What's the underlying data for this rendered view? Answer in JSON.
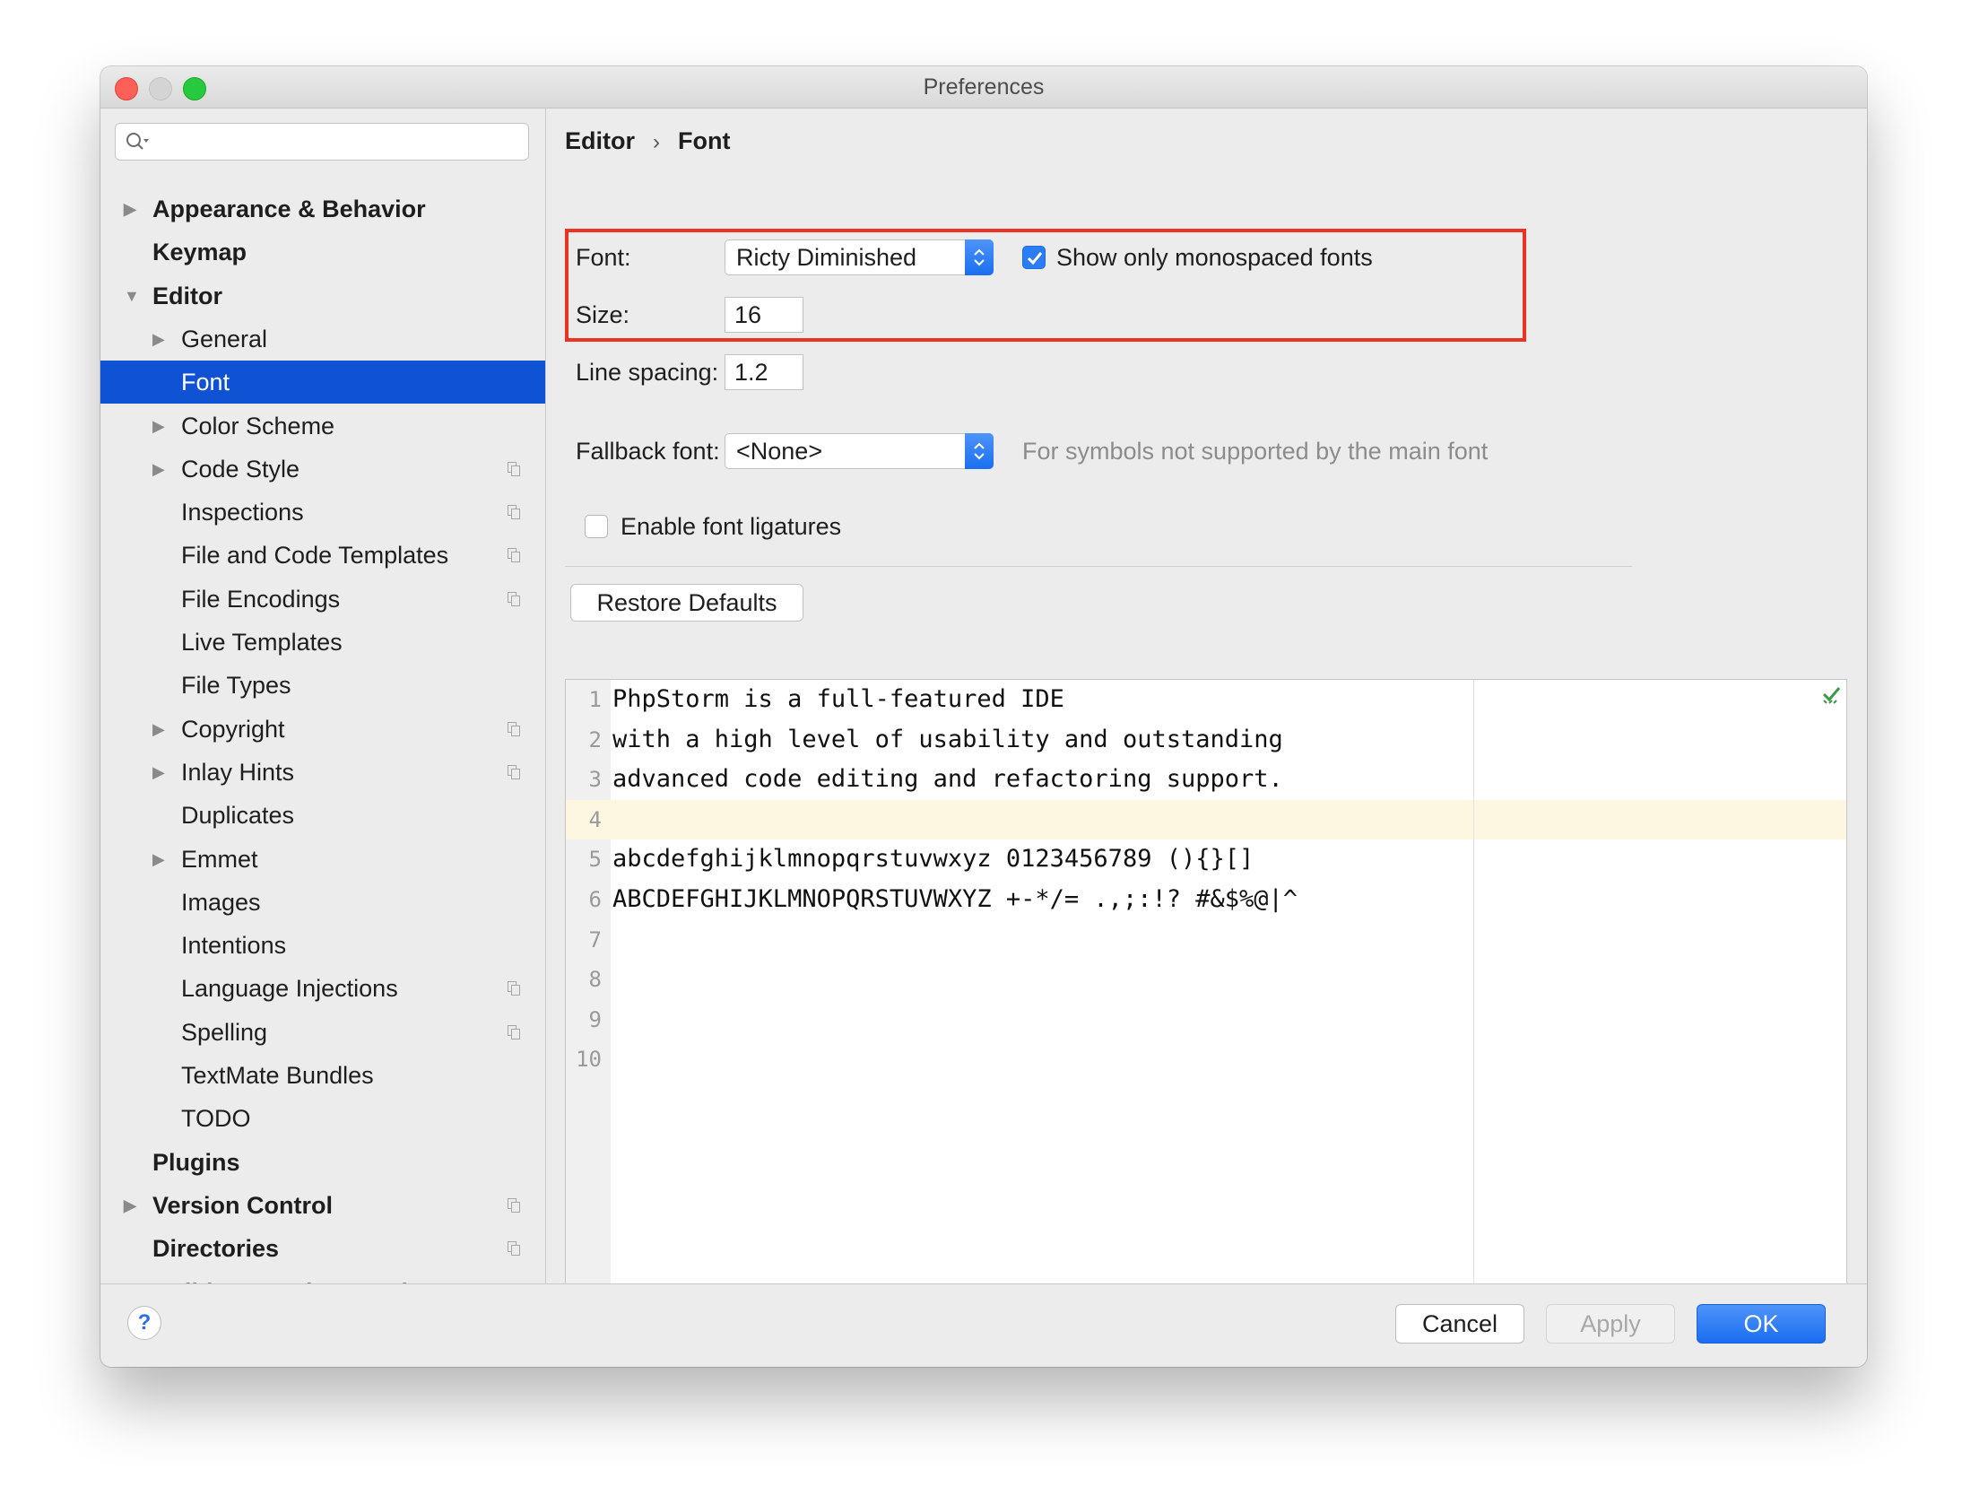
{
  "window": {
    "title": "Preferences"
  },
  "search": {
    "placeholder": ""
  },
  "sidebar": {
    "items": [
      {
        "label": "Appearance & Behavior",
        "level": 0,
        "arrow": "collapsed",
        "bold": true,
        "project": false,
        "selected": false
      },
      {
        "label": "Keymap",
        "level": 0,
        "arrow": "none",
        "bold": true,
        "project": false,
        "selected": false
      },
      {
        "label": "Editor",
        "level": 0,
        "arrow": "expanded",
        "bold": true,
        "project": false,
        "selected": false
      },
      {
        "label": "General",
        "level": 1,
        "arrow": "collapsed",
        "bold": false,
        "project": false,
        "selected": false
      },
      {
        "label": "Font",
        "level": 1,
        "arrow": "none",
        "bold": false,
        "project": false,
        "selected": true
      },
      {
        "label": "Color Scheme",
        "level": 1,
        "arrow": "collapsed",
        "bold": false,
        "project": false,
        "selected": false
      },
      {
        "label": "Code Style",
        "level": 1,
        "arrow": "collapsed",
        "bold": false,
        "project": true,
        "selected": false
      },
      {
        "label": "Inspections",
        "level": 1,
        "arrow": "none",
        "bold": false,
        "project": true,
        "selected": false
      },
      {
        "label": "File and Code Templates",
        "level": 1,
        "arrow": "none",
        "bold": false,
        "project": true,
        "selected": false
      },
      {
        "label": "File Encodings",
        "level": 1,
        "arrow": "none",
        "bold": false,
        "project": true,
        "selected": false
      },
      {
        "label": "Live Templates",
        "level": 1,
        "arrow": "none",
        "bold": false,
        "project": false,
        "selected": false
      },
      {
        "label": "File Types",
        "level": 1,
        "arrow": "none",
        "bold": false,
        "project": false,
        "selected": false
      },
      {
        "label": "Copyright",
        "level": 1,
        "arrow": "collapsed",
        "bold": false,
        "project": true,
        "selected": false
      },
      {
        "label": "Inlay Hints",
        "level": 1,
        "arrow": "collapsed",
        "bold": false,
        "project": true,
        "selected": false
      },
      {
        "label": "Duplicates",
        "level": 1,
        "arrow": "none",
        "bold": false,
        "project": false,
        "selected": false
      },
      {
        "label": "Emmet",
        "level": 1,
        "arrow": "collapsed",
        "bold": false,
        "project": false,
        "selected": false
      },
      {
        "label": "Images",
        "level": 1,
        "arrow": "none",
        "bold": false,
        "project": false,
        "selected": false
      },
      {
        "label": "Intentions",
        "level": 1,
        "arrow": "none",
        "bold": false,
        "project": false,
        "selected": false
      },
      {
        "label": "Language Injections",
        "level": 1,
        "arrow": "none",
        "bold": false,
        "project": true,
        "selected": false
      },
      {
        "label": "Spelling",
        "level": 1,
        "arrow": "none",
        "bold": false,
        "project": true,
        "selected": false
      },
      {
        "label": "TextMate Bundles",
        "level": 1,
        "arrow": "none",
        "bold": false,
        "project": false,
        "selected": false
      },
      {
        "label": "TODO",
        "level": 1,
        "arrow": "none",
        "bold": false,
        "project": false,
        "selected": false
      },
      {
        "label": "Plugins",
        "level": 0,
        "arrow": "none",
        "bold": true,
        "project": false,
        "selected": false
      },
      {
        "label": "Version Control",
        "level": 0,
        "arrow": "collapsed",
        "bold": true,
        "project": true,
        "selected": false
      },
      {
        "label": "Directories",
        "level": 0,
        "arrow": "none",
        "bold": true,
        "project": true,
        "selected": false
      },
      {
        "label": "Build, Execution, Deployment",
        "level": 0,
        "arrow": "collapsed",
        "bold": true,
        "project": false,
        "selected": false
      }
    ]
  },
  "breadcrumb": {
    "parent": "Editor",
    "separator": "›",
    "current": "Font"
  },
  "settings": {
    "font_label": "Font:",
    "font_value": "Ricty Diminished",
    "monospaced_label": "Show only monospaced fonts",
    "monospaced_checked": true,
    "size_label": "Size:",
    "size_value": "16",
    "line_spacing_label": "Line spacing:",
    "line_spacing_value": "1.2",
    "fallback_label": "Fallback font:",
    "fallback_value": "<None>",
    "fallback_hint": "For symbols not supported by the main font",
    "ligatures_label": "Enable font ligatures",
    "ligatures_checked": false,
    "restore_label": "Restore Defaults"
  },
  "preview": {
    "lines": [
      {
        "num": "1",
        "text": "PhpStorm is a full-featured IDE"
      },
      {
        "num": "2",
        "text": "with a high level of usability and outstanding"
      },
      {
        "num": "3",
        "text": "advanced code editing and refactoring support."
      },
      {
        "num": "4",
        "text": ""
      },
      {
        "num": "5",
        "text": "abcdefghijklmnopqrstuvwxyz 0123456789 (){}[]"
      },
      {
        "num": "6",
        "text": "ABCDEFGHIJKLMNOPQRSTUVWXYZ +-*/= .,;:!? #&$%@|^"
      },
      {
        "num": "7",
        "text": ""
      },
      {
        "num": "8",
        "text": ""
      },
      {
        "num": "9",
        "text": ""
      },
      {
        "num": "10",
        "text": ""
      }
    ],
    "current_line": 4
  },
  "footer": {
    "help": "?",
    "cancel": "Cancel",
    "apply": "Apply",
    "ok": "OK"
  },
  "colors": {
    "accent": "#0f52d4",
    "highlight_border": "#ea3323",
    "ok_button": "#1b6df0"
  }
}
